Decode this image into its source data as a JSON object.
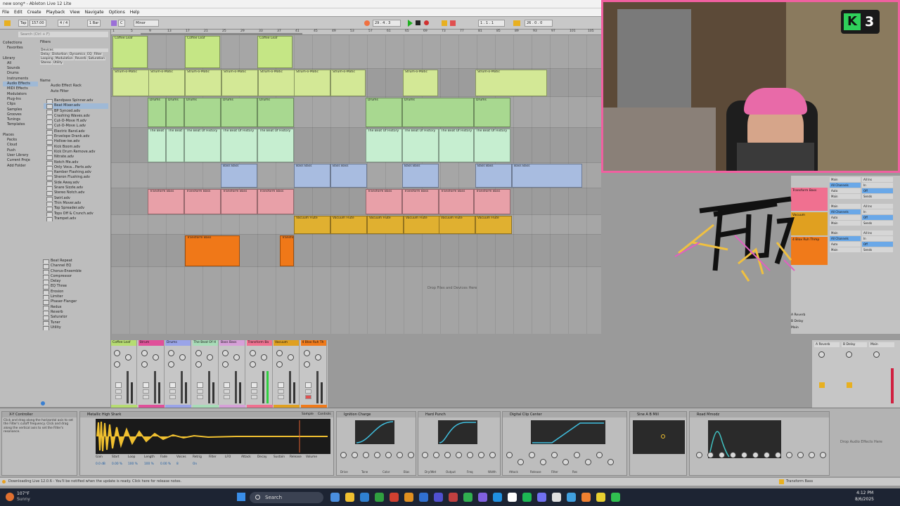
{
  "window": {
    "title": "new song* - Ableton Live 12 Lite"
  },
  "menu": [
    "File",
    "Edit",
    "Create",
    "Playback",
    "View",
    "Navigate",
    "Options",
    "Help"
  ],
  "transport": {
    "tap": "Tap",
    "tempo": "157.00",
    "sig": "4 / 4",
    "bar": "1 Bar",
    "key": "C",
    "scale": "Minor",
    "position": "29 . 4 . 3",
    "loop_start": "1 . 1 . 1",
    "loop_len": "26 . 0 . 0"
  },
  "browser": {
    "search_placeholder": "Search (Ctrl + F)",
    "filters_label": "Filters",
    "collections_label": "Collections",
    "favorites": "Favorites",
    "library_label": "Library",
    "library": [
      "All",
      "Sounds",
      "Drums",
      "Instruments",
      "Audio Effects",
      "MIDI Effects",
      "Modulators",
      "Plug-Ins",
      "Clips",
      "Samples",
      "Grooves",
      "Tunings",
      "Templates"
    ],
    "places_label": "Places",
    "places": [
      "Packs",
      "Cloud",
      "Push",
      "User Library",
      "Current Proje",
      "Add Folder"
    ],
    "tags": [
      "Devices",
      "Delay",
      "Distortion",
      "Dynamics",
      "EQ",
      "Filter",
      "Looping",
      "Modulation",
      "Reverb",
      "Saturation",
      "Stereo",
      "Utility"
    ],
    "name_header": "Name",
    "folders": [
      "Audio Effect Rack",
      "Auto Filter"
    ],
    "files": [
      "Bandpass Spinner.adv",
      "Beat Mixer.adv",
      "BP Synced.adv",
      "Crashing Waves.adv",
      "Cut-O-Move H.adv",
      "Cut-O-Move L.adv",
      "Electric Band.adv",
      "Envelope Drank.adv",
      "Hollow-ise.adv",
      "Kick Boom.adv",
      "Kick Drum Remove.adv",
      "Nitrate.adv",
      "Notch Me.adv",
      "Only Voca...Parts.adv",
      "Ramber Flashing.adv",
      "Sheron Flushing.adv",
      "Side Away.adv",
      "Snare Sizzle.adv",
      "Stereo Notch.adv",
      "Swirl.adv",
      "Thin Mover.adv",
      "Top Spreader.adv",
      "Tops Off & Crunch.adv",
      "Trampet.adv"
    ],
    "devices": [
      "Beat Repeat",
      "Channel EQ",
      "Chorus-Ensemble",
      "Compressor",
      "Delay",
      "EQ Three",
      "Erosion",
      "Limiter",
      "Phaser-Flanger",
      "Redux",
      "Reverb",
      "Saturator",
      "Tuner",
      "Utility"
    ]
  },
  "arrangement": {
    "drop_text": "Drop Files and Devices Here",
    "ruler": [
      "1",
      "5",
      "9",
      "13",
      "17",
      "21",
      "25",
      "29",
      "33",
      "37",
      "41",
      "45",
      "49",
      "53",
      "57",
      "61",
      "65",
      "69",
      "73",
      "77",
      "81",
      "85",
      "89",
      "93",
      "97",
      "101",
      "105"
    ],
    "clips": {
      "coffee": "Coffee Leaf",
      "strum": "Strum-o-Matic",
      "drums": "Drums",
      "history": "The Beat Of History",
      "bass": "Bass Bass",
      "transform": "Transform Bass",
      "vacuum": "Vacuum Flute",
      "transform_short": "Transform Bass"
    }
  },
  "tracks": [
    {
      "name": "Coffee Leaf",
      "color": "#b6dc72"
    },
    {
      "name": "Strum",
      "color": "#e0509a"
    },
    {
      "name": "Drums",
      "color": "#9aa4e8"
    },
    {
      "name": "The Beat Of H",
      "color": "#a8dcb8"
    },
    {
      "name": "Bass Bass",
      "color": "#d6a0d8"
    },
    {
      "name": "Transform Ba",
      "color": "#f07090"
    },
    {
      "name": "Vacuum",
      "color": "#e0a020"
    },
    {
      "name": "4 Blox Ruh Th",
      "color": "#f07a1a"
    }
  ],
  "returns": [
    {
      "name": "A Reverb"
    },
    {
      "name": "B Delay"
    },
    {
      "name": "Main"
    }
  ],
  "right_tracks": [
    "Transform Bass",
    "Vacuum",
    "4 Blox Ruh Thmp"
  ],
  "right_io": [
    "Main",
    "All Ins",
    "All Channels",
    "In",
    "Auto",
    "Off",
    "Main",
    "Sends"
  ],
  "devices": {
    "xy_title": "X-Y Controller",
    "xy_help": "Click and drag along the horizontal axis to set the Filter's cutoff frequency. Click and drag along the vertical axis to set the Filter's resonance.",
    "sample_title": "Metallic High Shark",
    "sample_tabs": [
      "Sample",
      "Controls"
    ],
    "sample_fields": [
      "Gain",
      "Start",
      "Loop",
      "Length",
      "Fade",
      "Voices",
      "Retrig",
      "Filter",
      "LFO",
      "Attack",
      "Decay",
      "Sustain",
      "Release",
      "Volume"
    ],
    "sample_values": [
      "0.0 dB",
      "0.00 %",
      "100 %",
      "100 %",
      "0.00 %",
      "8",
      "On"
    ],
    "ignition": "Ignition Charge",
    "hard_punch": "Hard Punch",
    "digital_clip": "Digital Clip Center",
    "sine_ab": "Sine A B Mill",
    "road_mmodz": "Road Mmodz",
    "drop_text": "Drop Audio Effects Here",
    "knob_labels": [
      "Drive",
      "Tone",
      "Color",
      "Bias",
      "Dry/Wet",
      "Output",
      "Freq",
      "Width",
      "Attack",
      "Release",
      "Filter",
      "Res"
    ]
  },
  "status": {
    "text": "Downloading Live 12.0.6 - You'll be notified when the update is ready. Click here for release notes.",
    "clip_label": "Transform Bass"
  },
  "video": {
    "badge_letter": "K",
    "badge_num": "3"
  },
  "taskbar": {
    "temp": "107°F",
    "weather": "Sunny",
    "search": "Search",
    "time": "4:12 PM",
    "date": "8/6/2025"
  }
}
